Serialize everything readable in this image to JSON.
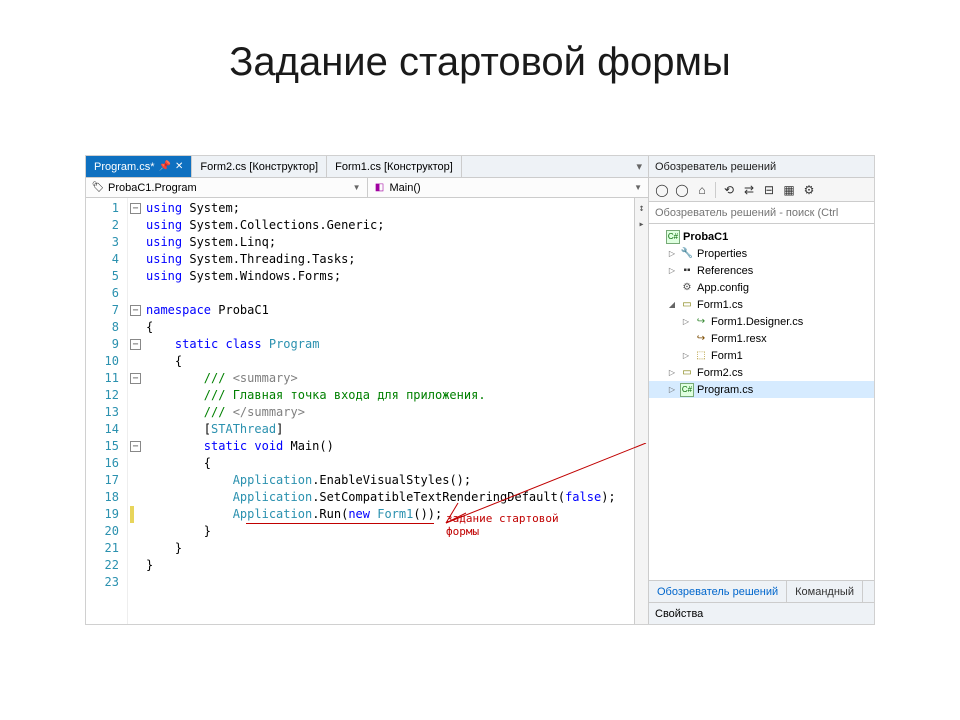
{
  "slide": {
    "title": "Задание стартовой формы"
  },
  "tabs": [
    {
      "label": "Program.cs*",
      "active": true
    },
    {
      "label": "Form2.cs [Конструктор]",
      "active": false
    },
    {
      "label": "Form1.cs [Конструктор]",
      "active": false
    }
  ],
  "nav": {
    "left": "ProbaC1.Program",
    "right": "Main()"
  },
  "code": {
    "lines": [
      {
        "n": 1,
        "fold": "box",
        "html": "<span class='kw'>using</span> System;"
      },
      {
        "n": 2,
        "fold": "",
        "html": "<span class='kw'>using</span> System.Collections.Generic;"
      },
      {
        "n": 3,
        "fold": "",
        "html": "<span class='kw'>using</span> System.Linq;"
      },
      {
        "n": 4,
        "fold": "",
        "html": "<span class='kw'>using</span> System.Threading.Tasks;"
      },
      {
        "n": 5,
        "fold": "",
        "html": "<span class='kw'>using</span> System.Windows.Forms;"
      },
      {
        "n": 6,
        "fold": "",
        "html": ""
      },
      {
        "n": 7,
        "fold": "box",
        "html": "<span class='kw'>namespace</span> ProbaC1"
      },
      {
        "n": 8,
        "fold": "",
        "html": "{"
      },
      {
        "n": 9,
        "fold": "box",
        "html": "    <span class='kw'>static class</span> <span class='typ'>Program</span>"
      },
      {
        "n": 10,
        "fold": "",
        "html": "    {"
      },
      {
        "n": 11,
        "fold": "box",
        "html": "        <span class='cm'>/// </span><span class='gray'>&lt;summary&gt;</span>"
      },
      {
        "n": 12,
        "fold": "",
        "html": "        <span class='cm'>/// Главная точка входа для приложения.</span>"
      },
      {
        "n": 13,
        "fold": "",
        "html": "        <span class='cm'>/// </span><span class='gray'>&lt;/summary&gt;</span>"
      },
      {
        "n": 14,
        "fold": "",
        "html": "        [<span class='typ'>STAThread</span>]"
      },
      {
        "n": 15,
        "fold": "box",
        "html": "        <span class='kw'>static void</span> Main()"
      },
      {
        "n": 16,
        "fold": "",
        "html": "        {"
      },
      {
        "n": 17,
        "fold": "",
        "html": "            <span class='typ'>Application</span>.EnableVisualStyles();"
      },
      {
        "n": 18,
        "fold": "",
        "html": "            <span class='typ'>Application</span>.SetCompatibleTextRenderingDefault(<span class='kw'>false</span>);"
      },
      {
        "n": 19,
        "fold": "",
        "mod": true,
        "html": "            <span class='typ'>Application</span>.Run(<span class='kw'>new</span> <span class='typ'>Form1</span>());"
      },
      {
        "n": 20,
        "fold": "",
        "html": "        }"
      },
      {
        "n": 21,
        "fold": "",
        "html": "    }"
      },
      {
        "n": 22,
        "fold": "",
        "html": "}"
      },
      {
        "n": 23,
        "fold": "",
        "html": ""
      }
    ]
  },
  "annotation": {
    "line1": "задание стартовой",
    "line2": "формы"
  },
  "solution": {
    "panel_title": "Обозреватель решений",
    "search_placeholder": "Обозреватель решений - поиск (Ctrl",
    "tree": [
      {
        "depth": 0,
        "caret": "",
        "icon": "cs-badge",
        "label": "ProbaC1",
        "bold": true
      },
      {
        "depth": 1,
        "caret": "▷",
        "icon": "wrench",
        "label": "Properties"
      },
      {
        "depth": 1,
        "caret": "▷",
        "icon": "ref",
        "label": "References"
      },
      {
        "depth": 1,
        "caret": "",
        "icon": "cfg",
        "label": "App.config"
      },
      {
        "depth": 1,
        "caret": "◢",
        "icon": "form",
        "label": "Form1.cs"
      },
      {
        "depth": 2,
        "caret": "▷",
        "icon": "cs",
        "label": "Form1.Designer.cs"
      },
      {
        "depth": 2,
        "caret": "",
        "icon": "resx",
        "label": "Form1.resx"
      },
      {
        "depth": 2,
        "caret": "▷",
        "icon": "frmcls",
        "label": "Form1"
      },
      {
        "depth": 1,
        "caret": "▷",
        "icon": "form",
        "label": "Form2.cs"
      },
      {
        "depth": 1,
        "caret": "▷",
        "icon": "cs-badge-sm",
        "label": "Program.cs",
        "selected": true
      }
    ],
    "bottom_tabs": {
      "active": "Обозреватель решений",
      "other": "Командный"
    },
    "props_title": "Свойства"
  }
}
